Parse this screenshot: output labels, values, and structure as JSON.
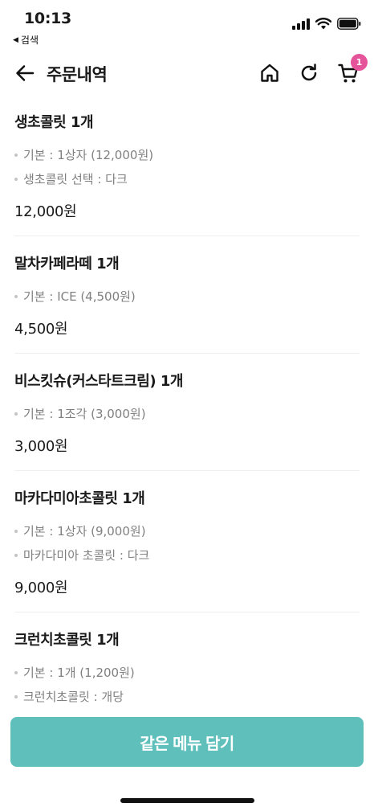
{
  "status_bar": {
    "time": "10:13",
    "back_app": "검색",
    "icons": [
      "signal-icon",
      "wifi-icon",
      "battery-icon"
    ]
  },
  "header": {
    "title": "주문내역",
    "cart_count": "1",
    "icons": [
      "back-arrow-icon",
      "home-icon",
      "refresh-icon",
      "cart-icon"
    ]
  },
  "orders": [
    {
      "name": "생초콜릿 1개",
      "options": [
        "기본 : 1상자 (12,000원)",
        "생초콜릿 선택 : 다크"
      ],
      "price": "12,000원"
    },
    {
      "name": "말차카페라떼 1개",
      "options": [
        "기본 : ICE (4,500원)"
      ],
      "price": "4,500원"
    },
    {
      "name": "비스킷슈(커스타트크림) 1개",
      "options": [
        "기본 : 1조각 (3,000원)"
      ],
      "price": "3,000원"
    },
    {
      "name": "마카다미아초콜릿 1개",
      "options": [
        "기본 : 1상자 (9,000원)",
        "마카다미아 초콜릿 : 다크"
      ],
      "price": "9,000원"
    },
    {
      "name": "크런치초콜릿 1개",
      "options": [
        "기본 : 1개 (1,200원)",
        "크런치초콜릿 : 개당"
      ],
      "price": ""
    }
  ],
  "footer": {
    "add_button_label": "같은 메뉴 담기"
  },
  "colors": {
    "accent": "#5fbfbb",
    "badge": "#e5539a",
    "muted_text": "#808080"
  }
}
